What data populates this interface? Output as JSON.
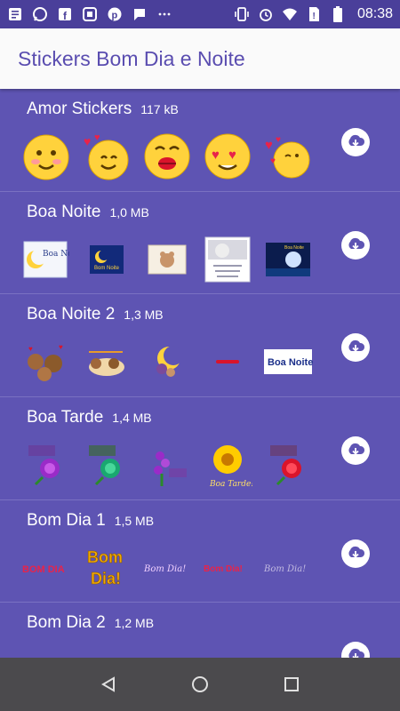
{
  "status": {
    "time": "08:38",
    "icons_left": [
      "notes-icon",
      "whatsapp-icon",
      "facebook-icon",
      "messenger-icon",
      "pinterest-icon",
      "chat-icon",
      "more-icon"
    ],
    "icons_right": [
      "vibrate-icon",
      "alarm-icon",
      "wifi-icon",
      "no-sim-icon",
      "battery-icon"
    ]
  },
  "appbar": {
    "title": "Stickers Bom Dia e Noite"
  },
  "packs": [
    {
      "name": "Amor Stickers",
      "size": "117 kB"
    },
    {
      "name": "Boa Noite",
      "size": "1,0 MB"
    },
    {
      "name": "Boa Noite 2",
      "size": "1,3 MB"
    },
    {
      "name": "Boa Tarde",
      "size": "1,4 MB"
    },
    {
      "name": "Bom Dia 1",
      "size": "1,5 MB"
    },
    {
      "name": "Bom Dia 2",
      "size": "1,2 MB"
    }
  ],
  "sticker_text": {
    "boa_noite_a": "Boa Noite",
    "boa_noite_b": "Bom Noite",
    "boa_noite_c": "Boa Noite",
    "boa_noite2_a": "Boa Noite",
    "bom_dia_a": "BOM DIA",
    "bom_dia_b": "Bom",
    "bom_dia_c": "Dia!",
    "bom_dia_d": "Bom Dia!",
    "bom_dia_e": "Bom Dia!",
    "bom_dia_f": "Bom Dia!",
    "boa_tarde": "Boa Tarde!"
  },
  "colors": {
    "list_bg": "#5e54b3",
    "title": "#5a4db0",
    "statusbar": "#4a3f9a",
    "navbar": "#4b4a4d"
  }
}
